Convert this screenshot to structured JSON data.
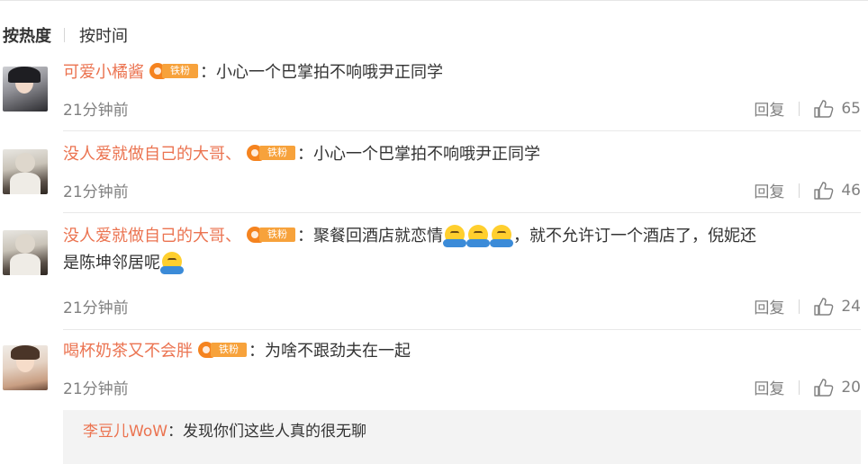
{
  "sort": {
    "hot": "按热度",
    "time": "按时间"
  },
  "badge_label": "铁粉",
  "comments": [
    {
      "user": "可爱小橘酱",
      "sep": "：",
      "text": "小心一个巴掌拍不响哦尹正同学",
      "time": "21分钟前",
      "reply": "回复",
      "likes": "65"
    },
    {
      "user": "没人爱就做自己的大哥、",
      "sep": "：",
      "text": "小心一个巴掌拍不响哦尹正同学",
      "time": "21分钟前",
      "reply": "回复",
      "likes": "46"
    },
    {
      "user": "没人爱就做自己的大哥、",
      "sep": "：",
      "text_a": "聚餐回酒店就恋情",
      "text_b": "，就不允许订一个酒店了，倪妮还",
      "text_c": "是陈坤邻居呢",
      "time": "21分钟前",
      "reply": "回复",
      "likes": "24"
    },
    {
      "user": "喝杯奶茶又不会胖",
      "sep": "：",
      "text": "为啥不跟劲夫在一起",
      "time": "21分钟前",
      "reply": "回复",
      "likes": "20"
    }
  ],
  "nested_reply": {
    "user": "李豆儿WoW",
    "sep": "：",
    "text": "发现你们这些人真的很无聊"
  },
  "colors": {
    "username": "#eb7350",
    "badge": "#f7a23b",
    "meta": "#808080"
  },
  "icons": {
    "like": "thumbs-up-icon",
    "emoji": "hug-emoji-icon",
    "badge": "fan-badge-icon"
  }
}
